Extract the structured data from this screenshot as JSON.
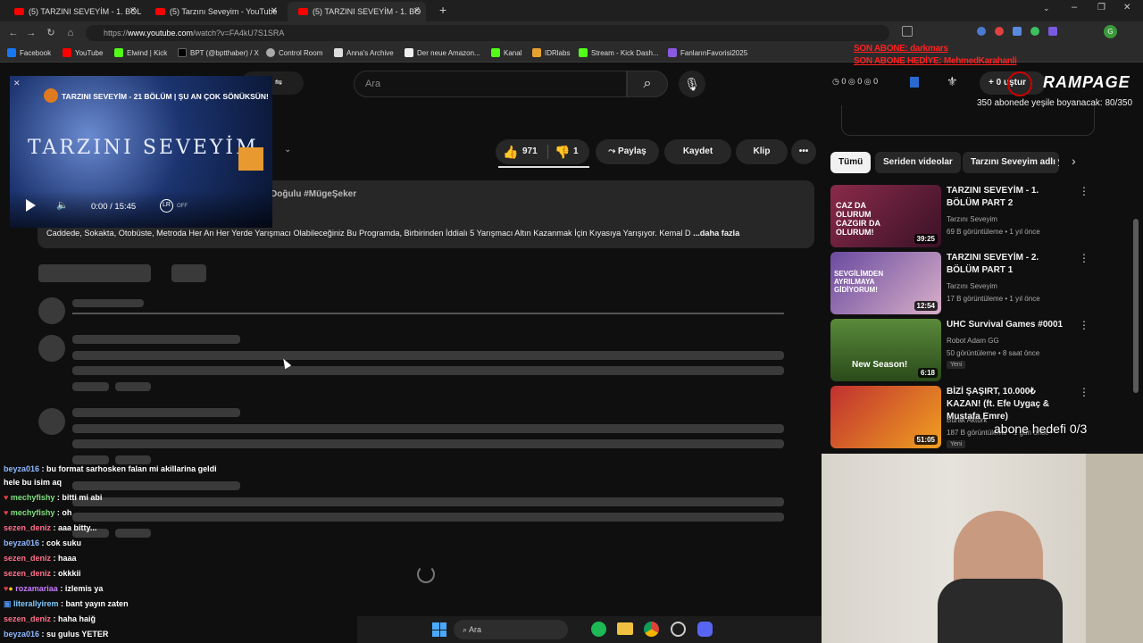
{
  "tabs": [
    {
      "title": "(5) TARZINI SEVEYİM - 1. BÖLÜM",
      "active": false
    },
    {
      "title": "(5) Tarzını Seveyim - YouTube",
      "active": false
    },
    {
      "title": "(5) TARZINI SEVEYİM - 1. BÖ",
      "active": true
    }
  ],
  "address": {
    "prefix": "https://",
    "host": "www.youtube.com",
    "path": "/watch?v=FA4kU7S1SRA"
  },
  "bookmarks": [
    "Facebook",
    "YouTube",
    "Elwind | Kick",
    "BPT (@bptthaber) / X",
    "Control Room",
    "Anna's Archive",
    "Der neue Amazon...",
    "Kanal",
    "IDRlabs",
    "Stream - Kick Dash...",
    "FanlarınFavorisi2025"
  ],
  "overlay": {
    "last_sub": "SON ABONE: darkmars",
    "last_gift": "SON ABONE HEDİYE: MehmedKarahanli",
    "counter1": "0",
    "counter2": "0",
    "counter3": "0",
    "brand": "RAMPAGE",
    "goal_text": "350 abonede yeşile boyanacak: 80/350",
    "sub_goal": "abone hedefi 0/3",
    "ustur": "0 uştur"
  },
  "youtube": {
    "search_placeholder": "Ara",
    "filters_label": "ler",
    "likes": "971",
    "dislikes": "1",
    "share": "Paylaş",
    "save": "Kaydet",
    "clip": "Klip",
    "desc_header": "Doğulu #MügeŞeker",
    "description": "Caddede, Sokakta, Otobüste, Metroda Her An Her Yerde Yarışmacı Olabileceğiniz Bu Programda, Birbirinden İddialı 5 Yarışmacı Altın Kazanmak İçin Kıyasıya Yarışıyor. Kemal D",
    "more": "...daha fazla"
  },
  "miniplayer": {
    "title": "TARZINI SEVEYİM - 21 BÖLÜM | ŞU AN ÇOK SÖNÜKSÜN!",
    "logo_text": "TARZINI SEVEYİM",
    "time": "0:00 / 15:45",
    "lr_state": "OFF"
  },
  "chips": [
    "Tümü",
    "Seriden videolar",
    "Tarzını Seveyim adlı y"
  ],
  "videos": [
    {
      "title": "TARZINI SEVEYİM - 1. BÖLÜM PART 2",
      "channel": "Tarzını Seveyim",
      "meta": "69 B görüntüleme • 1 yıl önce",
      "duration": "39:25",
      "thumb_text": "CAZ DA OLURUM CAZGIR DA OLURUM!",
      "badge": ""
    },
    {
      "title": "TARZINI SEVEYİM - 2. BÖLÜM PART 1",
      "channel": "Tarzını Seveyim",
      "meta": "17 B görüntüleme • 1 yıl önce",
      "duration": "12:54",
      "thumb_text": "SEVGİLİMDEN AYRILMAYA GİDİYORUM!",
      "badge": ""
    },
    {
      "title": "UHC Survival Games #0001",
      "channel": "Robot Adam GG",
      "meta": "50 görüntüleme • 8 saat önce",
      "duration": "6:18",
      "thumb_text": "New Season!",
      "badge": "Yeni"
    },
    {
      "title": "BİZİ ŞAŞIRT, 10.000₺ KAZAN! (ft. Efe Uygaç & Mustafa Emre)",
      "channel": "Burak Aktürk",
      "meta": "187 B görüntüleme • 1 gün önce",
      "duration": "51:05",
      "thumb_text": "",
      "badge": "Yeni"
    }
  ],
  "chat": [
    {
      "user": "beyza016",
      "color": "#8fb8ff",
      "msg": "bu format sarhosken falan mi akillarina geldi"
    },
    {
      "user": "",
      "color": "#ffffff",
      "msg": "hele bu isim aq"
    },
    {
      "user": "mechyfishy",
      "color": "#7ee07e",
      "msg": "bitti mi abi"
    },
    {
      "user": "mechyfishy",
      "color": "#7ee07e",
      "msg": "oh"
    },
    {
      "user": "sezen_deniz",
      "color": "#ff6f8a",
      "msg": "aaa bitty..."
    },
    {
      "user": "beyza016",
      "color": "#8fb8ff",
      "msg": "cok suku"
    },
    {
      "user": "sezen_deniz",
      "color": "#ff6f8a",
      "msg": "haaa"
    },
    {
      "user": "sezen_deniz",
      "color": "#ff6f8a",
      "msg": "okkkii"
    },
    {
      "user": "rozamariaa",
      "color": "#c77dff",
      "msg": "izlemis ya"
    },
    {
      "user": "literallyirem",
      "color": "#7ec8ff",
      "msg": "bant yayın zaten"
    },
    {
      "user": "sezen_deniz",
      "color": "#ff6f8a",
      "msg": "haha haiğ"
    },
    {
      "user": "beyza016",
      "color": "#8fb8ff",
      "msg": "su gulus YETER"
    }
  ],
  "taskbar": {
    "search": "Ara"
  },
  "icons": [
    "back-icon",
    "forward-icon",
    "reload-icon",
    "home-icon",
    "search-icon",
    "mic-icon",
    "like-icon",
    "dislike-icon",
    "share-icon",
    "more-icon",
    "play-icon",
    "volume-icon",
    "chevron-right-icon",
    "spinner-icon"
  ]
}
